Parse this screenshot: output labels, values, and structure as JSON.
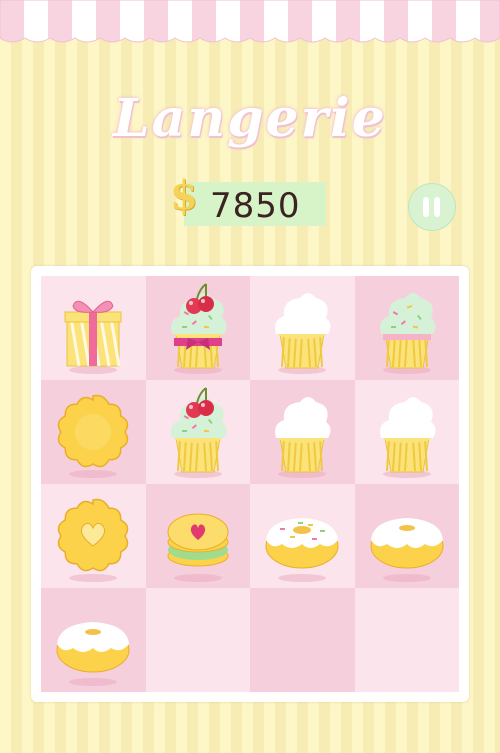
{
  "title": "Langerie",
  "currency_symbol": "$",
  "score": "7850",
  "colors": {
    "pink": "#f6cfdc",
    "light_pink": "#fbe4ec",
    "cream": "#fdf6c6",
    "mint": "#d7f3c8"
  },
  "board": {
    "rows": 4,
    "cols": 4,
    "tiles": [
      [
        "gift-box",
        "cherry-ribbon-cupcake",
        "cream-cupcake",
        "sprinkle-cupcake"
      ],
      [
        "flower-cookie",
        "cherry-cupcake",
        "cream-cupcake",
        "cream-cupcake"
      ],
      [
        "heart-cookie",
        "jam-sandwich-cookie",
        "sprinkle-donut",
        "glazed-donut"
      ],
      [
        "glazed-donut",
        "",
        "",
        ""
      ]
    ]
  }
}
